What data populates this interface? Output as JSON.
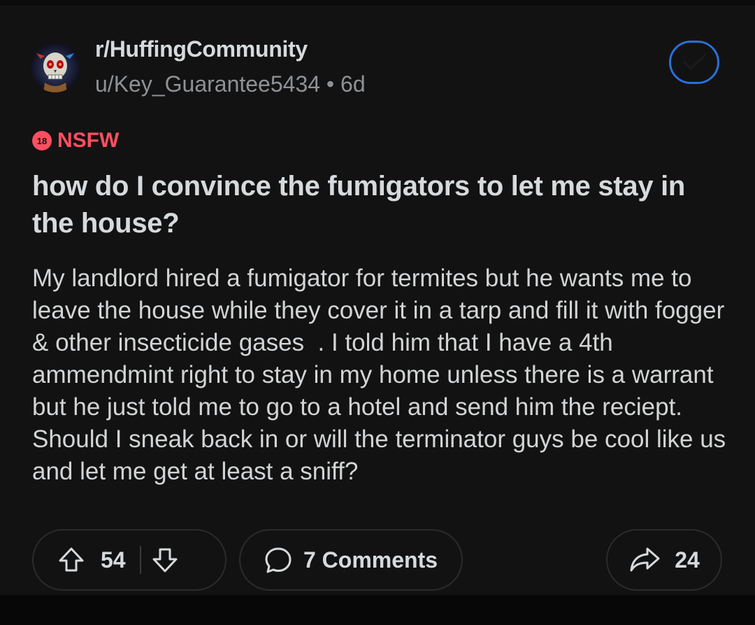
{
  "post": {
    "subreddit": "r/HuffingCommunity",
    "author": "u/Key_Guarantee5434",
    "separator": "•",
    "age": "6d",
    "nsfw_badge": "18",
    "nsfw_label": "NSFW",
    "title": "how do I convince the fumigators to let me stay in the house?",
    "body": "My landlord hired a fumigator for termites but he wants me to leave the house while they cover it in a tarp and fill it with fogger & other insecticide gases  . I told him that I have a 4th ammendmint right to stay in my home unless there is a warrant but he just told me to go to a hotel and send him the reciept.  Should I sneak back in or will the terminator guys be cool like us and let me get at least a sniff?"
  },
  "actions": {
    "upvotes": "54",
    "comments_label": "7 Comments",
    "shares": "24"
  },
  "colors": {
    "background": "#121212",
    "nsfw": "#ff4f61",
    "join_border": "#2b6fd9",
    "muted": "#8e9296"
  },
  "icons": {
    "avatar": "skull-avatar",
    "join": "checkmark-icon",
    "upvote": "upvote-arrow-icon",
    "downvote": "downvote-arrow-icon",
    "comment": "comment-bubble-icon",
    "share": "share-arrow-icon"
  }
}
